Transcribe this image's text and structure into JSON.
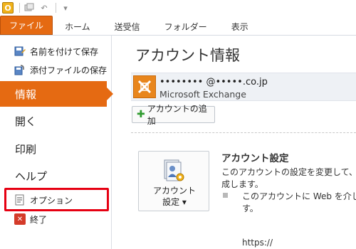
{
  "qat": {
    "app_letter": "O",
    "undo_glyph": "↶",
    "more_glyph": "▾"
  },
  "tabs": [
    {
      "label": "ファイル"
    },
    {
      "label": "ホーム"
    },
    {
      "label": "送受信"
    },
    {
      "label": "フォルダー"
    },
    {
      "label": "表示"
    }
  ],
  "nav": {
    "save_as": "名前を付けて保存",
    "save_attachments": "添付ファイルの保存",
    "info": "情報",
    "open": "開く",
    "print": "印刷",
    "help": "ヘルプ",
    "options": "オプション",
    "exit": "終了",
    "exit_glyph": "✕"
  },
  "main": {
    "title": "アカウント情報",
    "account_email": "•••••••• @•••••.co.jp",
    "account_type": "Microsoft Exchange",
    "add_account": "アカウントの追加",
    "settings_button_line1": "アカウント",
    "settings_button_line2": "設定 ▾",
    "section_title": "アカウント設定",
    "section_desc_line1": "このアカウントの設定を変更して、別の",
    "section_desc_line2": "成します。",
    "bullet_line1": "このアカウントに Web を介して",
    "bullet_line2": "す。",
    "url": "https://"
  },
  "colors": {
    "accent": "#e56a12",
    "highlight": "#e60012"
  }
}
